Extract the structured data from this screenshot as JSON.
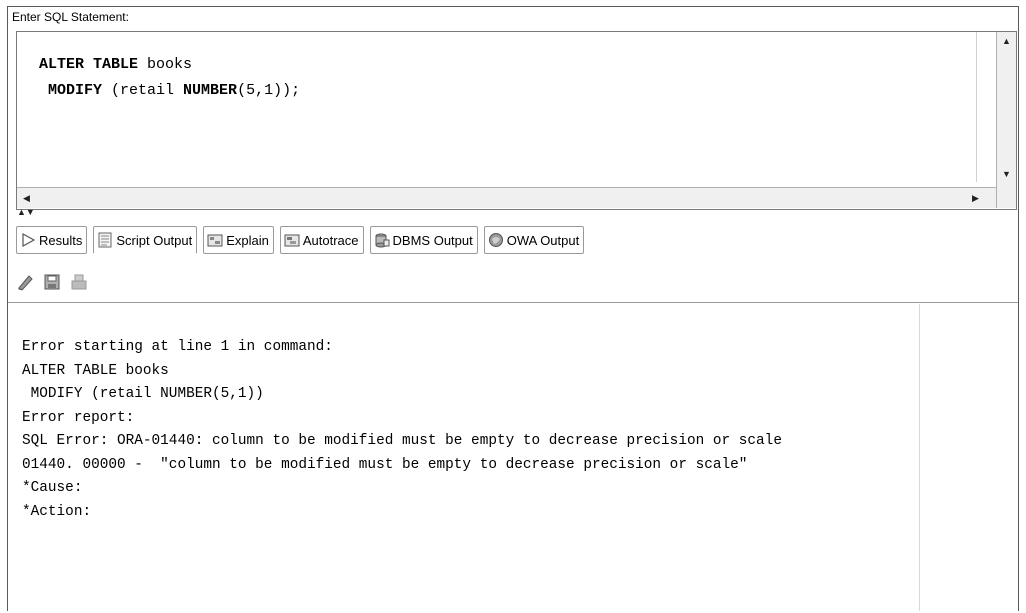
{
  "editor": {
    "label": "Enter SQL Statement:",
    "line1_kw": "ALTER TABLE",
    "line1_rest": " books",
    "line2_indent": " ",
    "line2_kw": "MODIFY",
    "line2_mid": " (retail ",
    "line2_kw2": "NUMBER",
    "line2_end": "(5,1));"
  },
  "tabs": [
    {
      "label": "Results",
      "icon": "play-triangle-icon"
    },
    {
      "label": "Script Output",
      "icon": "script-output-icon"
    },
    {
      "label": "Explain",
      "icon": "explain-plan-icon"
    },
    {
      "label": "Autotrace",
      "icon": "autotrace-icon"
    },
    {
      "label": "DBMS Output",
      "icon": "dbms-output-icon"
    },
    {
      "label": "OWA Output",
      "icon": "owa-output-icon"
    }
  ],
  "toolbar": {
    "icons": [
      "eraser-icon",
      "save-icon",
      "print-icon"
    ]
  },
  "output": {
    "lines": [
      "Error starting at line 1 in command:",
      "ALTER TABLE books",
      " MODIFY (retail NUMBER(5,1))",
      "Error report:",
      "SQL Error: ORA-01440: column to be modified must be empty to decrease precision or scale",
      "01440. 00000 -  \"column to be modified must be empty to decrease precision or scale\"",
      "*Cause:",
      "*Action:"
    ]
  }
}
